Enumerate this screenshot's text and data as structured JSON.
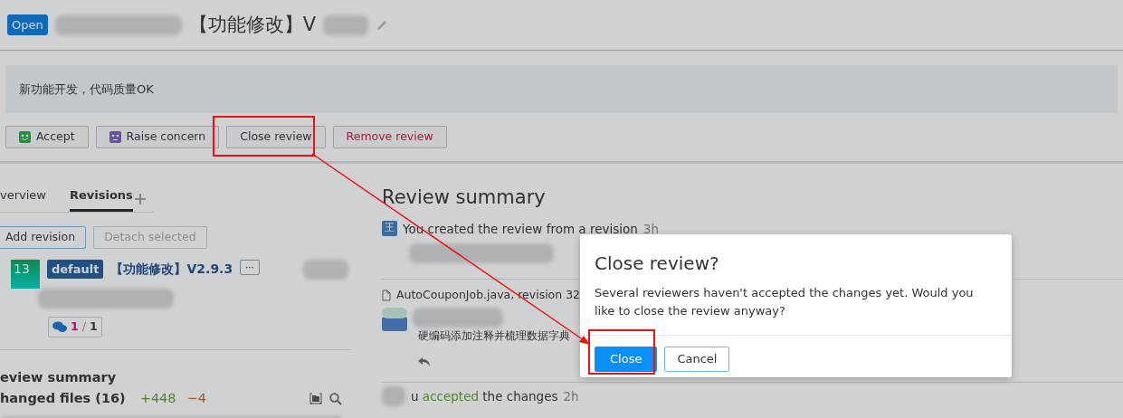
{
  "header": {
    "status_badge": "Open",
    "title_visible": "【功能修改】V",
    "title_redacted": true
  },
  "description": "新功能开发，代码质量OK",
  "actions": [
    {
      "label": "Accept",
      "kind": "accept"
    },
    {
      "label": "Raise concern",
      "kind": "concern"
    },
    {
      "label": "Close review",
      "kind": "plain"
    },
    {
      "label": "Remove review",
      "kind": "danger"
    }
  ],
  "tabs": [
    {
      "label": "verview",
      "selected": false
    },
    {
      "label": "Revisions",
      "selected": true
    }
  ],
  "revision_buttons": [
    {
      "label": "Add revision",
      "disabled": false
    },
    {
      "label": "Detach selected",
      "disabled": true
    }
  ],
  "revision": {
    "number": "13",
    "branch": "default",
    "title": "【功能修改】V2.9.3",
    "more": "···",
    "comments_unread": "1",
    "comments_sep": "/",
    "comments_total": "1"
  },
  "summary": {
    "heading": "eview summary",
    "files_label": "hanged files (16)",
    "added": "+448",
    "removed": "−4"
  },
  "feed": {
    "heading": "Review summary",
    "items": [
      {
        "kind": "event",
        "avatar": "王",
        "text": "You created the review from a revision",
        "time": "3h"
      },
      {
        "kind": "file",
        "text": "AutoCouponJob.java, revision 32"
      },
      {
        "kind": "comment",
        "text": "硬编码添加注释并梳理数据字典"
      },
      {
        "kind": "accepted",
        "pre": "u",
        "verb": "accepted",
        "post": "the changes",
        "time": "2h"
      }
    ]
  },
  "dialog": {
    "title": "Close review?",
    "message": "Several reviewers haven't accepted the changes yet. Would you like to close the review anyway?",
    "buttons": [
      {
        "label": "Close",
        "kind": "primary"
      },
      {
        "label": "Cancel",
        "kind": "secondary"
      }
    ]
  }
}
